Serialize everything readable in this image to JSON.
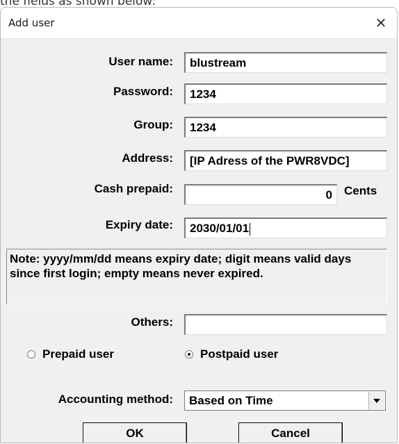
{
  "page_caption": "the fields as shown below:",
  "dialog": {
    "title": "Add user",
    "close_glyph": "✕"
  },
  "form": {
    "user_name": {
      "label": "User name:",
      "value": "blustream"
    },
    "password": {
      "label": "Password:",
      "value": "1234"
    },
    "group": {
      "label": "Group:",
      "value": "1234"
    },
    "address": {
      "label": "Address:",
      "value": "[IP Adress of the PWR8VDC]"
    },
    "cash_prepaid": {
      "label": "Cash prepaid:",
      "value": "0",
      "unit": "Cents"
    },
    "expiry_date": {
      "label": "Expiry date:",
      "value": "2030/01/01"
    },
    "note": "Note: yyyy/mm/dd means expiry date; digit means valid days since first login; empty means never expired.",
    "others": {
      "label": "Others:",
      "value": ""
    }
  },
  "user_type": {
    "prepaid_label": "Prepaid user",
    "postpaid_label": "Postpaid user",
    "selected": "postpaid"
  },
  "accounting": {
    "label": "Accounting method:",
    "selected": "Based on Time"
  },
  "buttons": {
    "ok": "OK",
    "cancel": "Cancel"
  },
  "icons": {
    "close": "close-icon",
    "dropdown": "chevron-down-icon"
  }
}
